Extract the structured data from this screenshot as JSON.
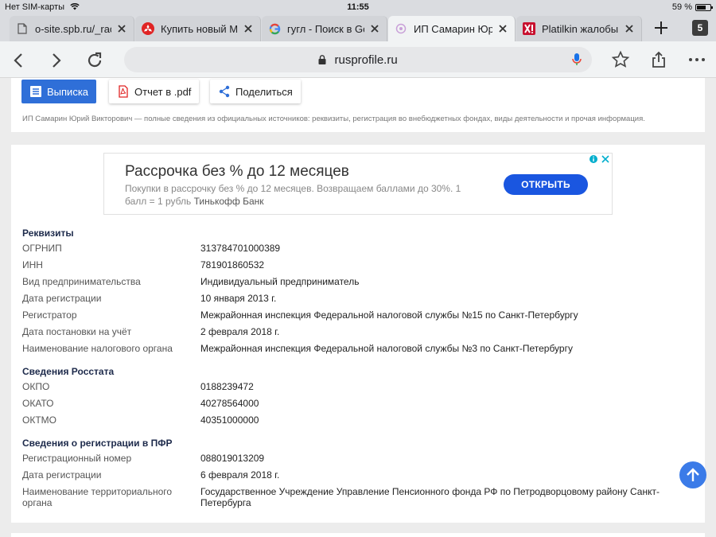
{
  "status": {
    "carrier": "Нет SIM-карты",
    "time": "11:55",
    "battery": "59 %"
  },
  "tabs": [
    {
      "title": "o-site.spb.ru/_race",
      "favicon": "document-icon",
      "active": false
    },
    {
      "title": "Купить новый Mit",
      "favicon": "mitsubishi-icon",
      "active": false
    },
    {
      "title": "гугл - Поиск в Go",
      "favicon": "google-icon",
      "active": false
    },
    {
      "title": "ИП Самарин Юри",
      "favicon": "rusprofile-icon",
      "active": true
    },
    {
      "title": "Platilkin жалобы",
      "favicon": "platilkin-icon",
      "active": false
    }
  ],
  "tab_count": "5",
  "address": {
    "url": "rusprofile.ru"
  },
  "actions": {
    "extract_label": "Выписка",
    "pdf_label": "Отчет в .pdf",
    "share_label": "Поделиться"
  },
  "description": "ИП Самарин Юрий Викторович — полные сведения из официальных источников: реквизиты, регистрация во внебюджетных фондах, виды деятельности и прочая информация.",
  "ad": {
    "title": "Рассрочка без % до 12 месяцев",
    "text": "Покупки в рассрочку без % до 12 месяцев. Возвращаем баллами до 30%. 1 балл = 1 рубль",
    "brand": "Тинькофф Банк",
    "button": "ОТКРЫТЬ"
  },
  "sections": {
    "requisites": {
      "title": "Реквизиты",
      "rows": [
        {
          "label": "ОГРНИП",
          "value": "313784701000389"
        },
        {
          "label": "ИНН",
          "value": "781901860532"
        },
        {
          "label": "Вид предпринимательства",
          "value": "Индивидуальный предприниматель"
        },
        {
          "label": "Дата регистрации",
          "value": "10 января 2013 г."
        },
        {
          "label": "Регистратор",
          "value": "Межрайонная инспекция Федеральной налоговой службы №15 по Санкт-Петербургу"
        },
        {
          "label": "Дата постановки на учёт",
          "value": "2 февраля 2018 г."
        },
        {
          "label": "Наименование налогового органа",
          "value": "Межрайонная инспекция Федеральной налоговой службы №3 по Санкт-Петербургу"
        }
      ]
    },
    "rosstat": {
      "title": "Сведения Росстата",
      "rows": [
        {
          "label": "ОКПО",
          "value": "0188239472"
        },
        {
          "label": "ОКАТО",
          "value": "40278564000"
        },
        {
          "label": "ОКТМО",
          "value": "40351000000"
        }
      ]
    },
    "pfr": {
      "title": "Сведения о регистрации в ПФР",
      "rows": [
        {
          "label": "Регистрационный номер",
          "value": "088019013209"
        },
        {
          "label": "Дата регистрации",
          "value": "6 февраля 2018 г."
        },
        {
          "label": "Наименование территориального органа",
          "value": "Государственное Учреждение Управление Пенсионного фонда РФ по Петродворцовому району Санкт-Петербурга"
        }
      ]
    }
  },
  "colors": {
    "accent": "#2f6fd8",
    "ad_button": "#1a56e0",
    "section_title": "#1d2a4b"
  }
}
